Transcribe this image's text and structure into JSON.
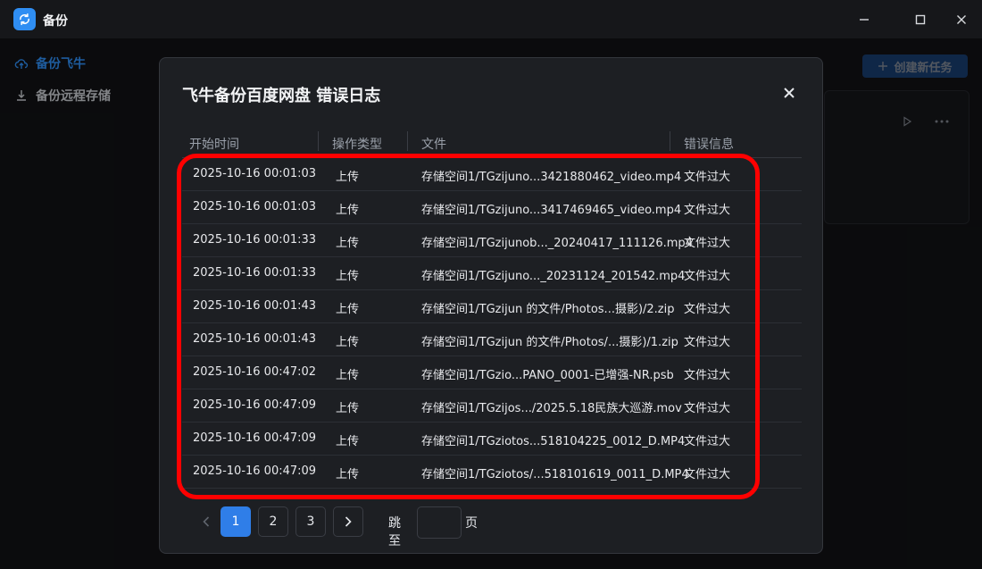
{
  "app": {
    "title": "备份"
  },
  "sidebar": {
    "items": [
      {
        "label": "备份飞牛"
      },
      {
        "label": "备份远程存储"
      }
    ]
  },
  "background": {
    "create_button": "创建新任务"
  },
  "modal": {
    "title": "飞牛备份百度网盘 错误日志",
    "columns": [
      "开始时间",
      "操作类型",
      "文件",
      "错误信息"
    ],
    "rows": [
      {
        "time": "2025-10-16 00:01:03",
        "op": "上传",
        "file": "存储空间1/TGzijuno...3421880462_video.mp4",
        "error": "文件过大"
      },
      {
        "time": "2025-10-16 00:01:03",
        "op": "上传",
        "file": "存储空间1/TGzijuno...3417469465_video.mp4",
        "error": "文件过大"
      },
      {
        "time": "2025-10-16 00:01:33",
        "op": "上传",
        "file": "存储空间1/TGzijunob..._20240417_111126.mp4",
        "error": "文件过大"
      },
      {
        "time": "2025-10-16 00:01:33",
        "op": "上传",
        "file": "存储空间1/TGzijuno..._20231124_201542.mp4",
        "error": "文件过大"
      },
      {
        "time": "2025-10-16 00:01:43",
        "op": "上传",
        "file": "存储空间1/TGzijun 的文件/Photos...摄影)/2.zip",
        "error": "文件过大"
      },
      {
        "time": "2025-10-16 00:01:43",
        "op": "上传",
        "file": "存储空间1/TGzijun 的文件/Photos/...摄影)/1.zip",
        "error": "文件过大"
      },
      {
        "time": "2025-10-16 00:47:02",
        "op": "上传",
        "file": "存储空间1/TGzio...PANO_0001-已增强-NR.psb",
        "error": "文件过大"
      },
      {
        "time": "2025-10-16 00:47:09",
        "op": "上传",
        "file": "存储空间1/TGzijos.../2025.5.18民族大巡游.mov",
        "error": "文件过大"
      },
      {
        "time": "2025-10-16 00:47:09",
        "op": "上传",
        "file": "存储空间1/TGziotos...518104225_0012_D.MP4",
        "error": "文件过大"
      },
      {
        "time": "2025-10-16 00:47:09",
        "op": "上传",
        "file": "存储空间1/TGziotos/...518101619_0011_D.MP4",
        "error": "文件过大"
      }
    ]
  },
  "pagination": {
    "pages": [
      "1",
      "2",
      "3"
    ],
    "current": "1",
    "jump_label": "跳至",
    "page_suffix": "页",
    "jump_value": ""
  },
  "colors": {
    "accent": "#2f7ee8",
    "highlight": "#ff0000",
    "modal_bg": "#1d1f23"
  },
  "icons": [
    "sync-icon",
    "minimize-icon",
    "maximize-icon",
    "close-icon",
    "cloud-upload-icon",
    "download-icon",
    "plus-icon",
    "play-icon",
    "more-icon",
    "chevron-left-icon",
    "chevron-right-icon"
  ]
}
